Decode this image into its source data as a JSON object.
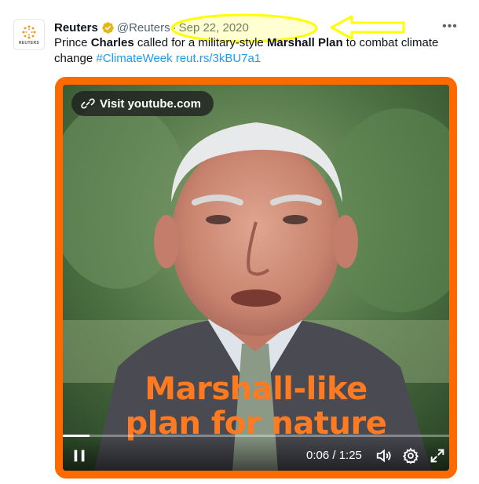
{
  "tweet": {
    "author_name": "Reuters",
    "handle": "@Reuters",
    "separator": "·",
    "date": "Sep 22, 2020",
    "avatar_label": "REUTERS",
    "more_label": "•••",
    "text": {
      "t1": "Prince ",
      "b1": "Charles",
      "t2": " called for a military-style ",
      "b2": "Marshall Plan",
      "t3": " to combat climate change ",
      "hashtag": "#ClimateWeek",
      "url": "reut.rs/3kBU7a1"
    }
  },
  "media": {
    "visit_label": "Visit youtube.com",
    "caption_line1": "Marshall-like",
    "caption_line2": "plan for nature",
    "time_display": "0:06 / 1:25",
    "progress_fraction": 0.07,
    "border_color": "#ff6a00"
  },
  "annotations": {
    "highlight_color": "#ffff00",
    "arrow_color": "#ffff00"
  },
  "icons": {
    "verified": "verified-badge-icon",
    "link": "link-icon",
    "pause": "pause-icon",
    "volume": "volume-icon",
    "settings": "gear-icon",
    "fullscreen": "fullscreen-icon",
    "more": "more-icon"
  }
}
